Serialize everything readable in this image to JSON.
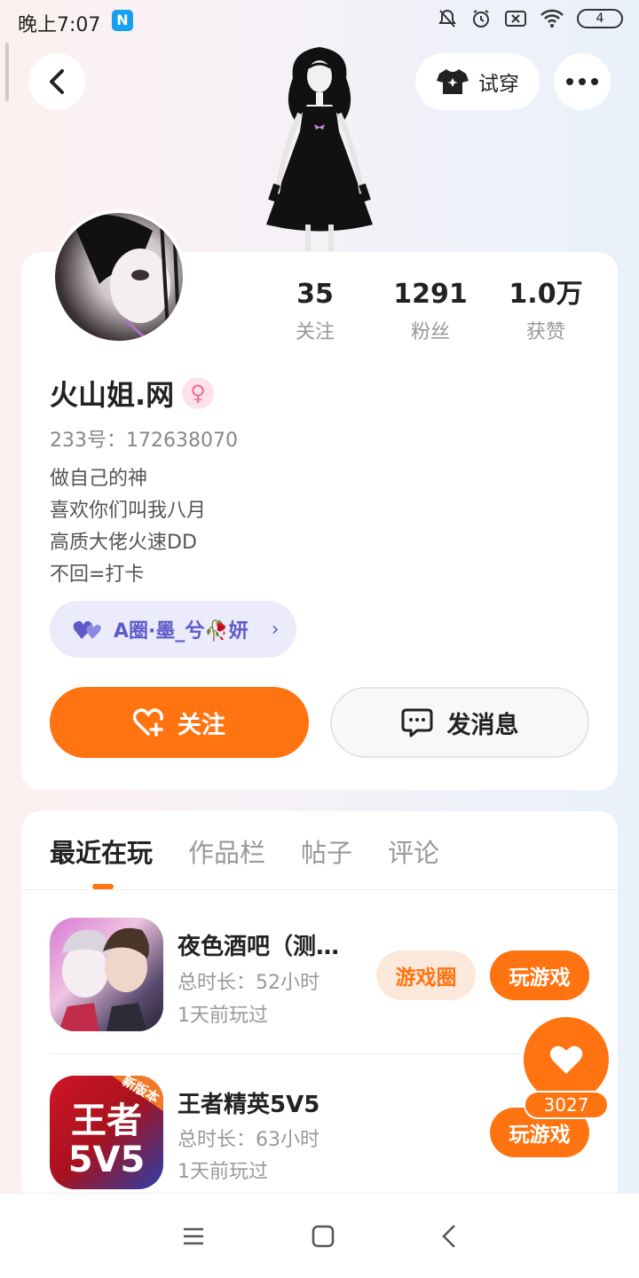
{
  "status_bar": {
    "time": "晚上7:07",
    "app_badge": "N",
    "battery": "4"
  },
  "header": {
    "try_on_label": "试穿"
  },
  "profile": {
    "stats": [
      {
        "value": "35",
        "label": "关注"
      },
      {
        "value": "1291",
        "label": "粉丝"
      },
      {
        "value": "1.0万",
        "label": "获赞"
      }
    ],
    "nickname": "火山姐.网",
    "gender_symbol": "♀",
    "user_id": "233号：172638070",
    "bio_lines": [
      "做自己的神",
      "喜欢你们叫我八月",
      "高质大佬火速DD",
      "不回=打卡"
    ],
    "circle_tag": "A圈·墨_兮🥀妍",
    "follow_label": "关注",
    "message_label": "发消息"
  },
  "tabs": [
    {
      "label": "最近在玩",
      "active": true
    },
    {
      "label": "作品栏",
      "active": false
    },
    {
      "label": "帖子",
      "active": false
    },
    {
      "label": "评论",
      "active": false
    }
  ],
  "games": [
    {
      "name": "夜色酒吧（测…",
      "duration": "总时长：52小时",
      "last_played": "1天前玩过",
      "circle_label": "游戏圈",
      "play_label": "玩游戏"
    },
    {
      "name": "王者精英5V5",
      "duration": "总时长：63小时",
      "last_played": "1天前玩过",
      "play_label": "玩游戏",
      "icon_text": "王者5V5",
      "icon_badge": "新版本"
    }
  ],
  "like_fab": {
    "count": "3027"
  },
  "colors": {
    "accent": "#ff7310",
    "circle_tag_bg": "#ecebfb",
    "circle_tag_fg": "#5d5bc9"
  }
}
